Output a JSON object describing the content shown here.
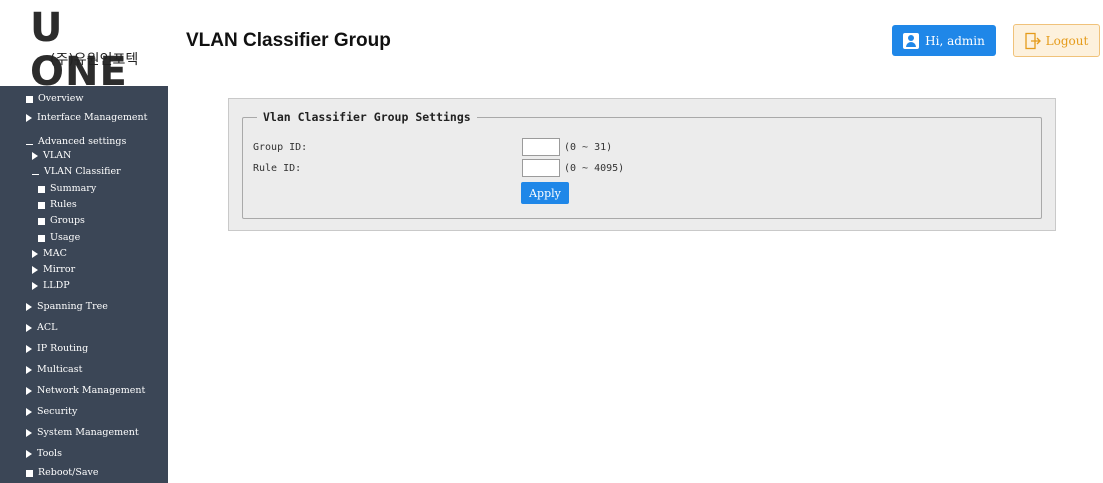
{
  "header": {
    "logo_main": "U ONE",
    "logo_sub": "(주)유원인포텍",
    "page_title": "VLAN Classifier Group",
    "user_label": "Hi, admin",
    "logout_label": "Logout"
  },
  "sidebar": {
    "items": [
      {
        "label": "Overview",
        "icon": "square"
      },
      {
        "label": "Interface Management",
        "icon": "triangle"
      },
      {
        "label": "Advanced settings",
        "icon": "dash"
      },
      {
        "label": "VLAN",
        "icon": "triangle"
      },
      {
        "label": "VLAN Classifier",
        "icon": "dash"
      },
      {
        "label": "Summary",
        "icon": "square"
      },
      {
        "label": "Rules",
        "icon": "square"
      },
      {
        "label": "Groups",
        "icon": "square"
      },
      {
        "label": "Usage",
        "icon": "square"
      },
      {
        "label": "MAC",
        "icon": "triangle"
      },
      {
        "label": "Mirror",
        "icon": "triangle"
      },
      {
        "label": "LLDP",
        "icon": "triangle"
      },
      {
        "label": "Spanning Tree",
        "icon": "triangle"
      },
      {
        "label": "ACL",
        "icon": "triangle"
      },
      {
        "label": "IP Routing",
        "icon": "triangle"
      },
      {
        "label": "Multicast",
        "icon": "triangle"
      },
      {
        "label": "Network Management",
        "icon": "triangle"
      },
      {
        "label": "Security",
        "icon": "triangle"
      },
      {
        "label": "System Management",
        "icon": "triangle"
      },
      {
        "label": "Tools",
        "icon": "triangle"
      },
      {
        "label": "Reboot/Save",
        "icon": "square"
      }
    ]
  },
  "form": {
    "legend": "Vlan Classifier Group Settings",
    "group_id_label": "Group ID:",
    "group_id_value": "",
    "group_id_range": "(0 ~ 31)",
    "rule_id_label": "Rule ID:",
    "rule_id_value": "",
    "rule_id_range": "(0 ~ 4095)",
    "apply_label": "Apply"
  },
  "colors": {
    "sidebar_bg": "#3b4656",
    "primary_blue": "#1f87e8",
    "logout_accent": "#e59b1a",
    "panel_bg": "#ececec"
  }
}
